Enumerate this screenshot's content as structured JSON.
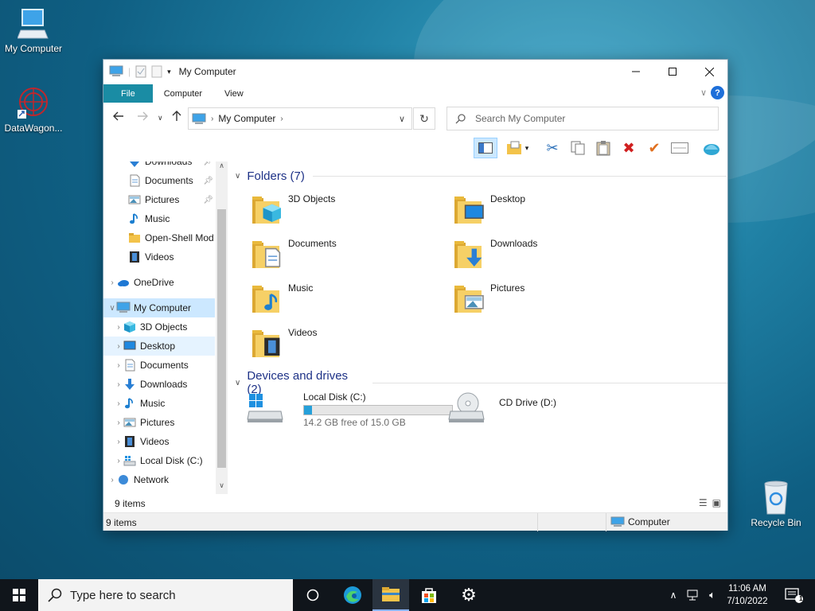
{
  "desktop": {
    "icons": [
      {
        "label": "My Computer"
      },
      {
        "label": "DataWagon..."
      },
      {
        "label": "Recycle Bin"
      }
    ]
  },
  "window": {
    "title": "My Computer",
    "ribbon_tabs": [
      "File",
      "Computer",
      "View"
    ],
    "help_label": "?",
    "address": "My Computer",
    "search_placeholder": "Search My Computer",
    "sidebar": [
      {
        "label": "Downloads",
        "icon": "download-arrow-icon",
        "pinned": true
      },
      {
        "label": "Documents",
        "icon": "document-icon",
        "pinned": true
      },
      {
        "label": "Pictures",
        "icon": "picture-icon",
        "pinned": true
      },
      {
        "label": "Music",
        "icon": "music-note-icon"
      },
      {
        "label": "Open-Shell Mod",
        "icon": "folder-icon"
      },
      {
        "label": "Videos",
        "icon": "film-icon"
      },
      {
        "label": "OneDrive",
        "icon": "cloud-icon"
      },
      {
        "label": "My Computer",
        "icon": "computer-icon",
        "selected": true
      },
      {
        "label": "3D Objects",
        "icon": "cube-icon"
      },
      {
        "label": "Desktop",
        "icon": "desktop-icon",
        "hover": true
      },
      {
        "label": "Documents",
        "icon": "document-icon"
      },
      {
        "label": "Downloads",
        "icon": "download-arrow-icon"
      },
      {
        "label": "Music",
        "icon": "music-note-icon"
      },
      {
        "label": "Pictures",
        "icon": "picture-icon"
      },
      {
        "label": "Videos",
        "icon": "film-icon"
      },
      {
        "label": "Local Disk (C:)",
        "icon": "drive-icon"
      },
      {
        "label": "Network",
        "icon": "network-icon"
      }
    ],
    "folders_header": "Folders (7)",
    "folders": [
      {
        "label": "3D Objects",
        "icon": "cube-icon"
      },
      {
        "label": "Desktop",
        "icon": "desktop-icon"
      },
      {
        "label": "Documents",
        "icon": "document-icon"
      },
      {
        "label": "Downloads",
        "icon": "download-arrow-icon"
      },
      {
        "label": "Music",
        "icon": "music-note-icon"
      },
      {
        "label": "Pictures",
        "icon": "picture-icon"
      },
      {
        "label": "Videos",
        "icon": "film-icon"
      }
    ],
    "devices_header": "Devices and drives (2)",
    "drives": [
      {
        "label": "Local Disk (C:)",
        "free_text": "14.2 GB free of 15.0 GB",
        "used_fraction": 0.053
      },
      {
        "label": "CD Drive (D:)"
      }
    ],
    "details_count": "9 items",
    "status_count": "9 items",
    "status_location": "Computer"
  },
  "taskbar": {
    "search_placeholder": "Type here to search",
    "time": "11:06 AM",
    "date": "7/10/2022",
    "notification_count": "1"
  },
  "colors": {
    "accent": "#1a8ca4",
    "selection": "#cce8ff",
    "header_blue": "#1e3287",
    "progress": "#26a0da",
    "folder_yellow": "#f3c34a"
  }
}
